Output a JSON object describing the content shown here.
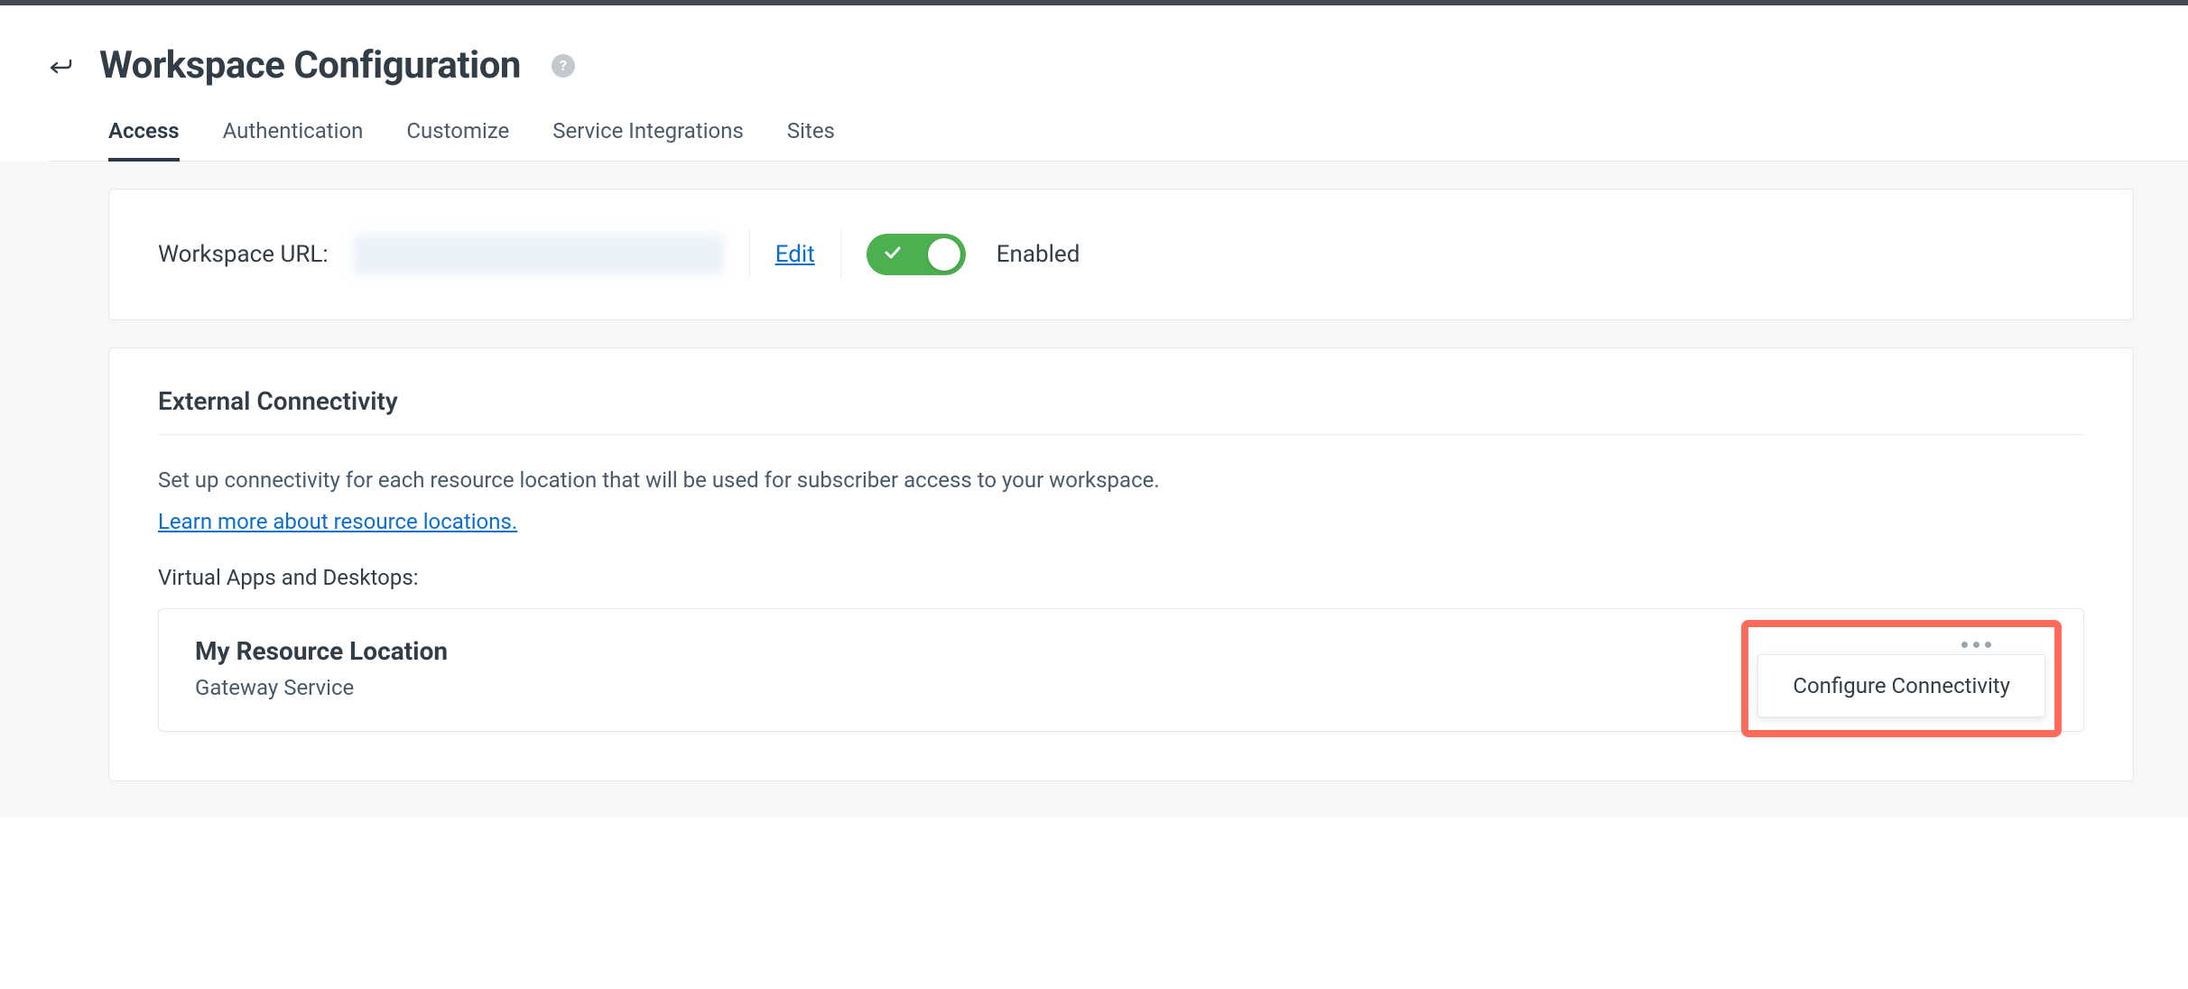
{
  "page": {
    "title": "Workspace Configuration"
  },
  "tabs": {
    "access": "Access",
    "authentication": "Authentication",
    "customize": "Customize",
    "service_integrations": "Service Integrations",
    "sites": "Sites"
  },
  "workspace_url": {
    "label": "Workspace URL:",
    "edit": "Edit",
    "toggle_state": "Enabled"
  },
  "external_connectivity": {
    "title": "External Connectivity",
    "description": "Set up connectivity for each resource location that will be used for subscriber access to your workspace.",
    "learn_more": "Learn more about resource locations.",
    "vad_label": "Virtual Apps and Desktops:",
    "resource": {
      "name": "My Resource Location",
      "service": "Gateway Service"
    },
    "menu": {
      "configure": "Configure Connectivity"
    }
  }
}
